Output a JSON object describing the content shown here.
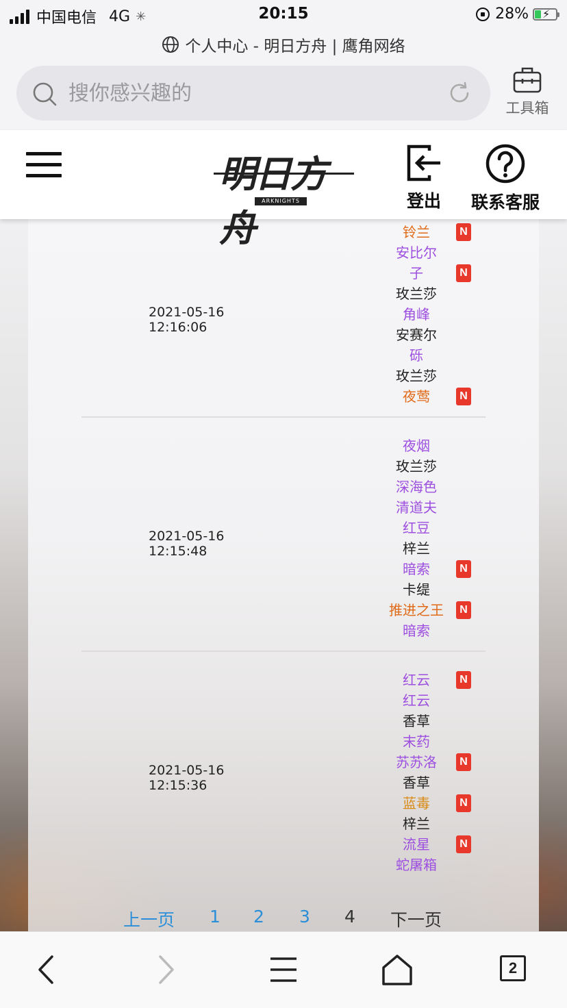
{
  "status_bar": {
    "carrier": "中国电信",
    "network": "4G",
    "time": "20:15",
    "battery": "28%"
  },
  "browser": {
    "page_title": "个人中心 - 明日方舟 | 鹰角网络",
    "search_placeholder": "搜你感兴趣的",
    "toolbox_label": "工具箱",
    "tab_count": "2"
  },
  "header": {
    "logo_text": "明日方舟",
    "logo_sub": "ARKNIGHTS",
    "logout_label": "登出",
    "service_label": "联系客服"
  },
  "new_badge": "N",
  "records": [
    {
      "time": "2021-05-16 12:16:06",
      "ops": [
        {
          "name": "铃兰",
          "color": "#e06a18",
          "new": true
        },
        {
          "name": "安比尔",
          "color": "#9d4fe0",
          "new": false
        },
        {
          "name": "子",
          "color": "#9d4fe0",
          "new": true
        },
        {
          "name": "玫兰莎",
          "color": "#222222",
          "new": false
        },
        {
          "name": "角峰",
          "color": "#9d4fe0",
          "new": false
        },
        {
          "name": "安赛尔",
          "color": "#222222",
          "new": false
        },
        {
          "name": "砾",
          "color": "#9d4fe0",
          "new": false
        },
        {
          "name": "玫兰莎",
          "color": "#222222",
          "new": false
        },
        {
          "name": "夜莺",
          "color": "#e06a18",
          "new": true
        }
      ]
    },
    {
      "time": "2021-05-16 12:15:48",
      "ops": [
        {
          "name": "夜烟",
          "color": "#9d4fe0",
          "new": false
        },
        {
          "name": "玫兰莎",
          "color": "#222222",
          "new": false
        },
        {
          "name": "深海色",
          "color": "#9d4fe0",
          "new": false
        },
        {
          "name": "清道夫",
          "color": "#9d4fe0",
          "new": false
        },
        {
          "name": "红豆",
          "color": "#9d4fe0",
          "new": false
        },
        {
          "name": "梓兰",
          "color": "#222222",
          "new": false
        },
        {
          "name": "暗索",
          "color": "#9d4fe0",
          "new": true
        },
        {
          "name": "卡缇",
          "color": "#222222",
          "new": false
        },
        {
          "name": "推进之王",
          "color": "#e06a18",
          "new": true
        },
        {
          "name": "暗索",
          "color": "#9d4fe0",
          "new": false
        }
      ]
    },
    {
      "time": "2021-05-16 12:15:36",
      "ops": [
        {
          "name": "红云",
          "color": "#9d4fe0",
          "new": true
        },
        {
          "name": "红云",
          "color": "#9d4fe0",
          "new": false
        },
        {
          "name": "香草",
          "color": "#222222",
          "new": false
        },
        {
          "name": "末药",
          "color": "#9d4fe0",
          "new": false
        },
        {
          "name": "苏苏洛",
          "color": "#9d4fe0",
          "new": true
        },
        {
          "name": "香草",
          "color": "#222222",
          "new": false
        },
        {
          "name": "蓝毒",
          "color": "#d98a14",
          "new": true
        },
        {
          "name": "梓兰",
          "color": "#222222",
          "new": false
        },
        {
          "name": "流星",
          "color": "#9d4fe0",
          "new": true
        },
        {
          "name": "蛇屠箱",
          "color": "#9d4fe0",
          "new": false
        }
      ]
    }
  ],
  "pagination": {
    "prev": "上一页",
    "pages": [
      "1",
      "2",
      "3",
      "4"
    ],
    "current": "4",
    "next": "下一页"
  }
}
